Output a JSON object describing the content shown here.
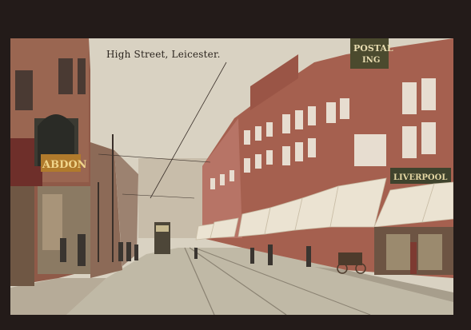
{
  "postcard": {
    "caption": "High Street, Leicester.",
    "signs": {
      "left_shop": "ABDON",
      "right_top": "POSTAL",
      "right_top_line2": "ING",
      "right_shop": "LIVERPOOL"
    }
  },
  "colors": {
    "border": "#231b19",
    "sky": "#d9d2c2",
    "brick": "#a5604f",
    "road": "#bcb6a4",
    "awning": "#ebe3d2"
  }
}
